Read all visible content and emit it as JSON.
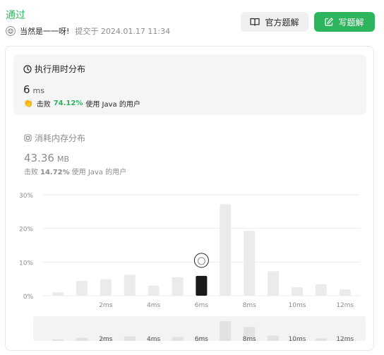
{
  "header": {
    "status": "通过",
    "username": "当然是一一呀!",
    "submitted": "提交于 2024.01.17 11:34",
    "official_solution_label": "官方题解",
    "write_solution_label": "写题解"
  },
  "runtime": {
    "title": "执行用时分布",
    "value": "6",
    "unit": "ms",
    "beats_prefix": "击败",
    "beats_pct": "74.12%",
    "beats_suffix": "使用 Java 的用户"
  },
  "memory": {
    "title": "消耗内存分布",
    "value": "43.36",
    "unit": "MB",
    "beats_prefix": "击败",
    "beats_pct": "14.72%",
    "beats_suffix": "使用 Java 的用户"
  },
  "colors": {
    "accent": "#2db55d",
    "bar": "#ebebeb",
    "bar_selected": "#1a1a1a"
  },
  "chart_data": {
    "type": "bar",
    "ylim": [
      0,
      30
    ],
    "yticks": [
      "30%",
      "20%",
      "10%",
      "0%"
    ],
    "ytick_values": [
      30,
      20,
      10,
      0
    ],
    "x_tick_labels": [
      "2ms",
      "4ms",
      "6ms",
      "8ms",
      "10ms",
      "12ms"
    ],
    "x_tick_bar_index": [
      2,
      4,
      6,
      8,
      10,
      12
    ],
    "values": [
      1.0,
      4.4,
      4.9,
      6.2,
      3.0,
      5.5,
      5.9,
      27.2,
      19.3,
      7.3,
      2.5,
      3.4,
      1.9
    ],
    "selected_index": 6,
    "overview_x_tick_labels": [
      "2ms",
      "4ms",
      "6ms",
      "8ms",
      "10ms",
      "12ms"
    ]
  }
}
